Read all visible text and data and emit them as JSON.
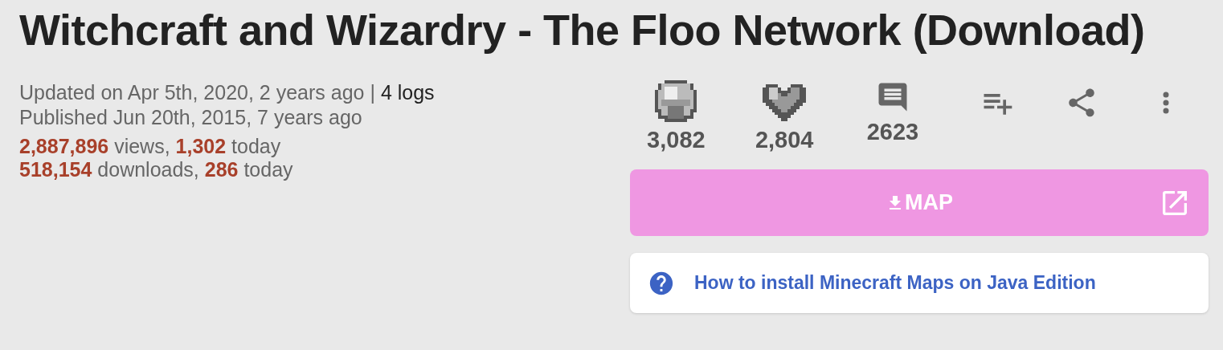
{
  "title": "Witchcraft and Wizardry - The Floo Network (Download)",
  "meta": {
    "updated": "Updated on Apr 5th, 2020, 2 years ago | ",
    "logs_link": "4 logs",
    "published": "Published Jun 20th, 2015, 7 years ago"
  },
  "stats_lines": [
    "**2,887,896** views, **1,302** today",
    "**518,154** downloads, **286** today"
  ],
  "counters": [
    {
      "kind": "diamond",
      "count": "3,082"
    },
    {
      "kind": "heart",
      "count": "2,804"
    },
    {
      "kind": "comment",
      "count": "2623"
    }
  ],
  "actions": [
    {
      "kind": "playlist-add"
    },
    {
      "kind": "share"
    },
    {
      "kind": "more"
    }
  ],
  "download_button": {
    "label": "MAP"
  },
  "help_link": {
    "label": "How to install Minecraft Maps on Java Edition"
  }
}
